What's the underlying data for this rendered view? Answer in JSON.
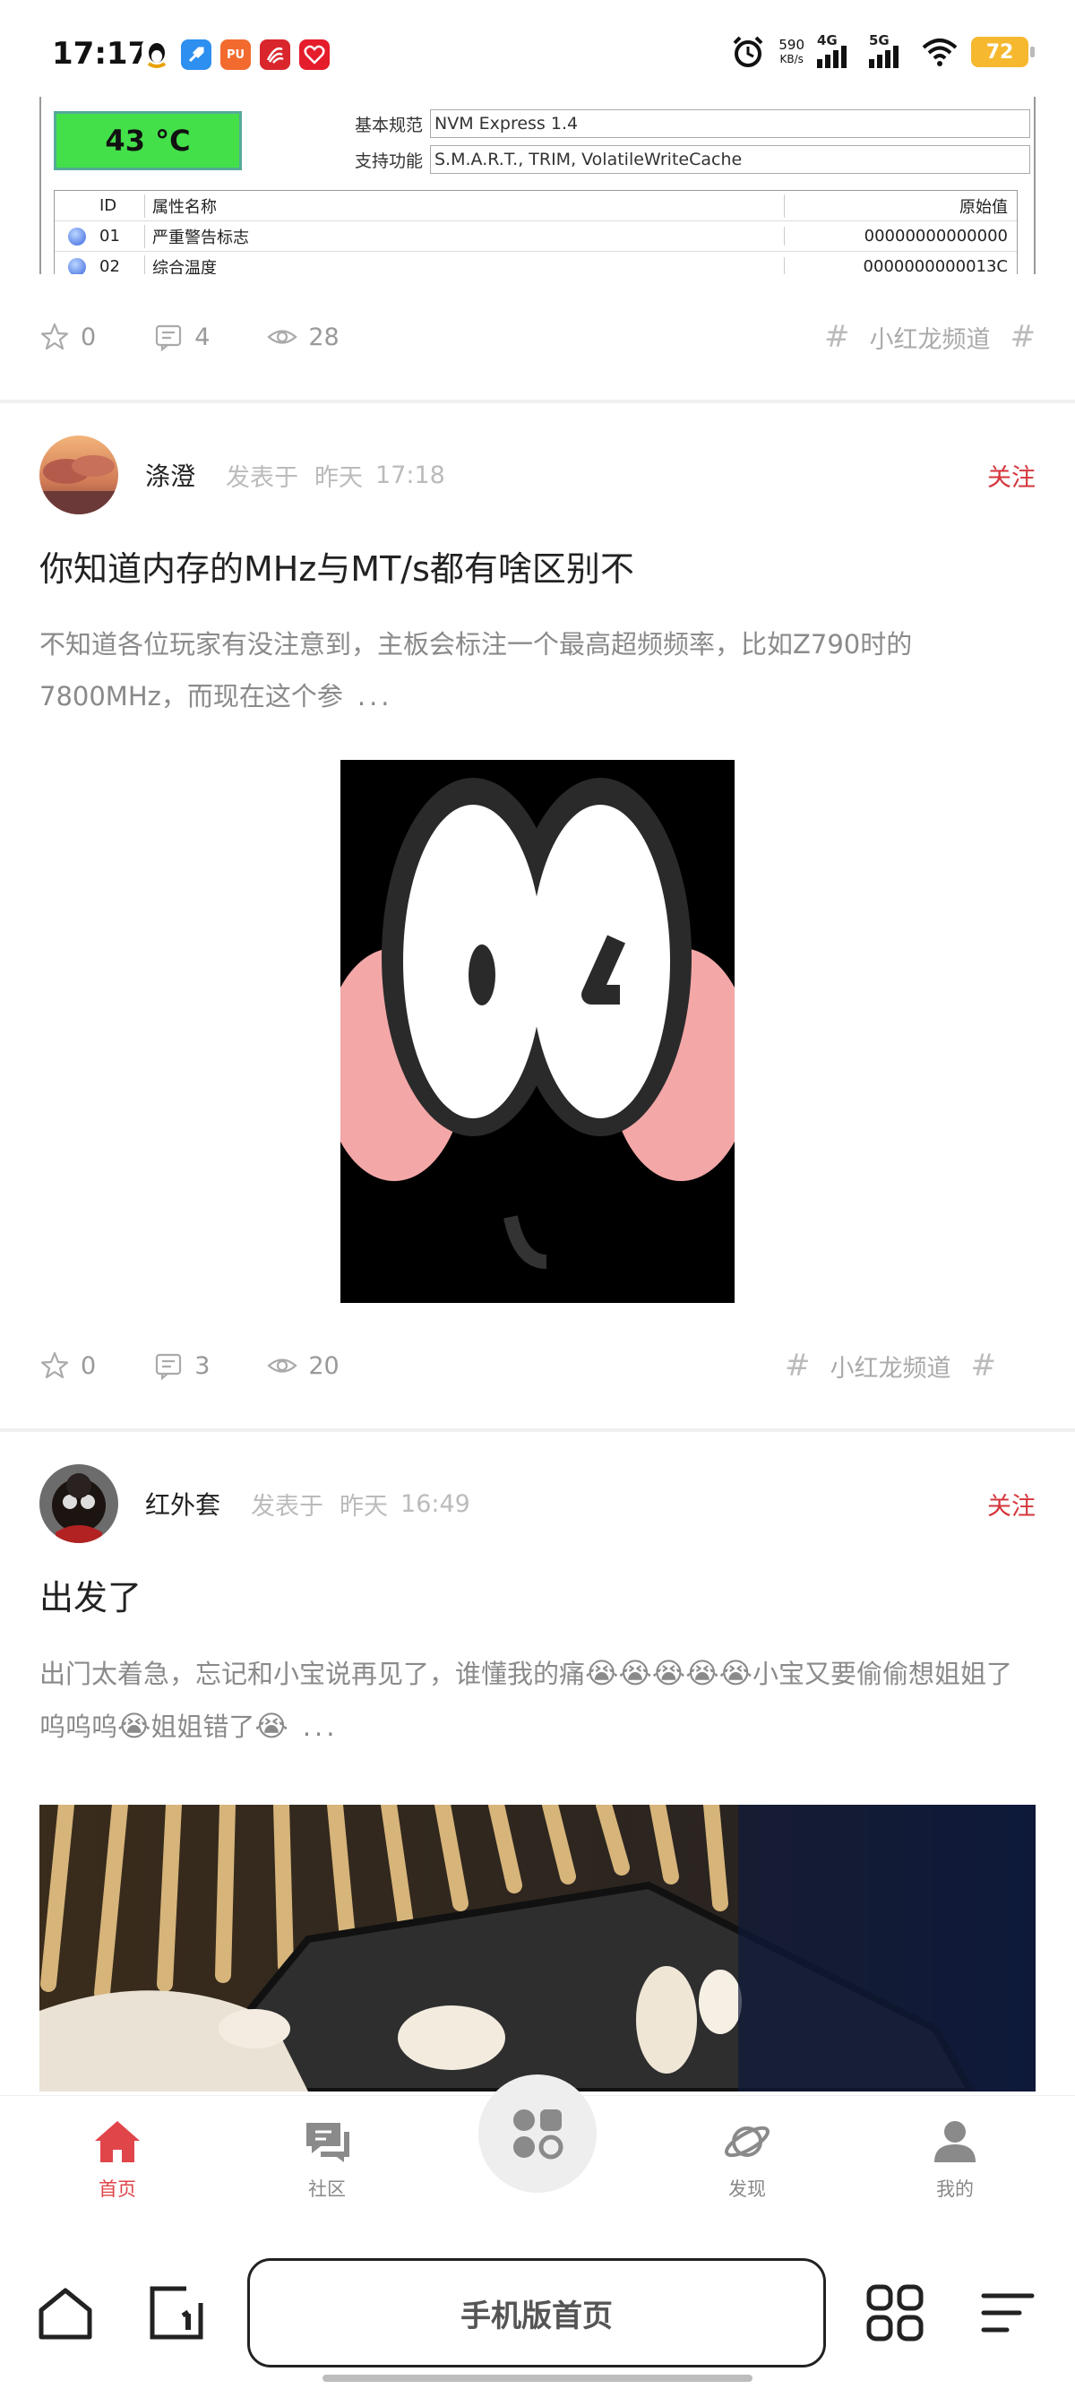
{
  "status_bar": {
    "time": "17:17",
    "net_speed_value": "590",
    "net_speed_unit": "KB/s",
    "signal1_label": "4G",
    "signal2_label": "5G",
    "battery": "72"
  },
  "prev_post": {
    "image": {
      "temperature": "43 °C",
      "spec_rows": [
        {
          "key": "基本规范",
          "value": "NVM Express 1.4"
        },
        {
          "key": "支持功能",
          "value": "S.M.A.R.T., TRIM, VolatileWriteCache"
        }
      ],
      "table_headers": [
        "ID",
        "属性名称",
        "原始值"
      ],
      "table_rows": [
        {
          "id": "01",
          "name": "严重警告标志",
          "raw": "00000000000000"
        },
        {
          "id": "02",
          "name": "综合温度",
          "raw": "0000000000013C"
        }
      ]
    },
    "stars": "0",
    "comments": "4",
    "views": "28",
    "channel": "小红龙频道"
  },
  "posts": [
    {
      "author": "涤澄",
      "posted_label": "发表于",
      "posted_day": "昨天",
      "posted_time": "17:18",
      "follow": "关注",
      "title": "你知道内存的MHz与MT/s都有啥区别不",
      "excerpt": "不知道各位玩家有没注意到，主板会标注一个最高超频频率，比如Z790时的7800MHz，而现在这个参",
      "ellipsis": "...",
      "stars": "0",
      "comments": "3",
      "views": "20",
      "channel": "小红龙频道"
    },
    {
      "author": "红外套",
      "posted_label": "发表于",
      "posted_day": "昨天",
      "posted_time": "16:49",
      "follow": "关注",
      "title": "出发了",
      "excerpt_a": "出门太着急，忘记和小宝说再见了，谁懂我的痛",
      "excerpt_emoji": "😭😭😭😭😭",
      "excerpt_b": "小宝又要偷偷想姐姐了呜呜呜",
      "excerpt_emoji2": "😭",
      "excerpt_c": "姐姐错了",
      "excerpt_emoji3": "😭",
      "ellipsis": "..."
    }
  ],
  "bottom_nav": {
    "items": [
      {
        "label": "首页",
        "icon": "home-icon",
        "active": true
      },
      {
        "label": "社区",
        "icon": "chat-icon",
        "active": false
      },
      {
        "label": "发现",
        "icon": "planet-icon",
        "active": false
      },
      {
        "label": "我的",
        "icon": "user-icon",
        "active": false
      }
    ],
    "center_icon": "apps-icon"
  },
  "browser_bar": {
    "url_label": "手机版首页"
  },
  "colors": {
    "accent": "#e0454a",
    "follow": "#d4363c",
    "muted": "#999999"
  }
}
